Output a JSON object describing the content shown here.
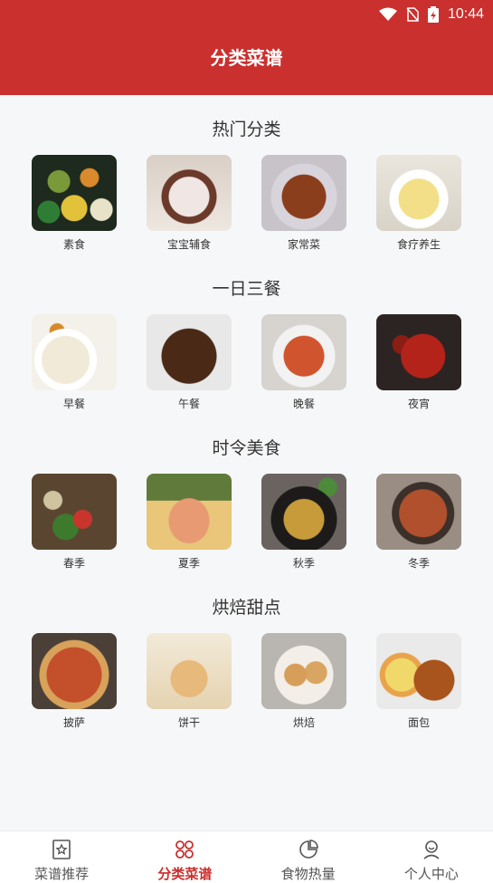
{
  "status": {
    "time": "10:44"
  },
  "header": {
    "title": "分类菜谱"
  },
  "sections": [
    {
      "title": "热门分类",
      "items": [
        "素食",
        "宝宝辅食",
        "家常菜",
        "食疗养生"
      ]
    },
    {
      "title": "一日三餐",
      "items": [
        "早餐",
        "午餐",
        "晚餐",
        "夜宵"
      ]
    },
    {
      "title": "时令美食",
      "items": [
        "春季",
        "夏季",
        "秋季",
        "冬季"
      ]
    },
    {
      "title": "烘焙甜点",
      "items": [
        "披萨",
        "饼干",
        "烘焙",
        "面包"
      ]
    }
  ],
  "tabbar": {
    "items": [
      {
        "label": "菜谱推荐",
        "icon": "star-doc-icon"
      },
      {
        "label": "分类菜谱",
        "icon": "grid-icon"
      },
      {
        "label": "食物热量",
        "icon": "pie-chart-icon"
      },
      {
        "label": "个人中心",
        "icon": "user-icon"
      }
    ],
    "active": 1,
    "active_color": "#c9302e"
  },
  "colors": {
    "header": "#c9302e",
    "background": "#f6f7f9"
  }
}
